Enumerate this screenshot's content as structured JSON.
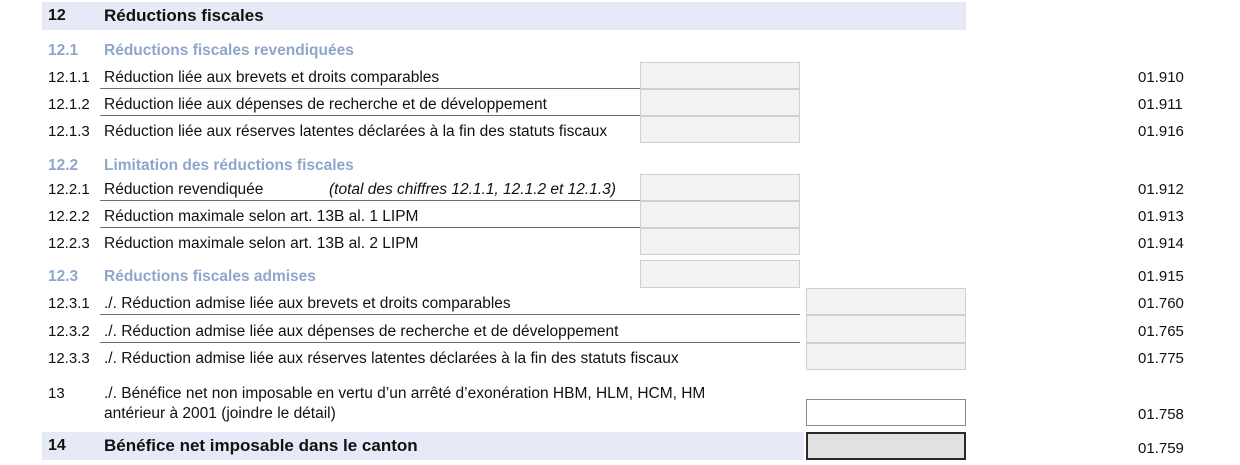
{
  "section12": {
    "number": "12",
    "title": "Réductions fiscales",
    "sub1": {
      "number": "12.1",
      "title": "Réductions fiscales revendiquées",
      "rows": [
        {
          "num": "12.1.1",
          "label": "Réduction liée aux brevets et droits comparables",
          "code": "01.910"
        },
        {
          "num": "12.1.2",
          "label": "Réduction liée aux dépenses de recherche et de développement",
          "code": "01.911"
        },
        {
          "num": "12.1.3",
          "label": "Réduction liée aux réserves latentes déclarées à la fin des statuts fiscaux",
          "code": "01.916"
        }
      ]
    },
    "sub2": {
      "number": "12.2",
      "title": "Limitation des réductions fiscales",
      "rows": [
        {
          "num": "12.2.1",
          "label": "Réduction revendiquée",
          "note": "(total des chiffres 12.1.1, 12.1.2 et 12.1.3)",
          "code": "01.912"
        },
        {
          "num": "12.2.2",
          "label": "Réduction maximale selon art. 13B al. 1 LIPM",
          "code": "01.913"
        },
        {
          "num": "12.2.3",
          "label": "Réduction maximale selon art. 13B al. 2 LIPM",
          "code": "01.914"
        }
      ]
    },
    "sub3": {
      "number": "12.3",
      "title": "Réductions fiscales admises",
      "code": "01.915",
      "rows": [
        {
          "num": "12.3.1",
          "label": "./. Réduction admise liée aux brevets et droits comparables",
          "code": "01.760"
        },
        {
          "num": "12.3.2",
          "label": "./. Réduction admise liée aux dépenses de recherche et de développement",
          "code": "01.765"
        },
        {
          "num": "12.3.3",
          "label": "./. Réduction admise liée aux réserves latentes déclarées à la fin des statuts fiscaux",
          "code": "01.775"
        }
      ]
    }
  },
  "row13": {
    "number": "13",
    "label_line1": "./. Bénéfice net non imposable en vertu d’un arrêté d’exonération HBM, HLM, HCM, HM",
    "label_line2": "antérieur à 2001 (joindre le détail)",
    "code": "01.758"
  },
  "row14": {
    "number": "14",
    "title": "Bénéfice net imposable dans le canton",
    "code": "01.759"
  },
  "colors": {
    "header_bg": "#e6eaf6",
    "section_title": "#8ea6cc",
    "field_bg": "#f2f2f2",
    "total_field_bg": "#e1e1e1"
  }
}
